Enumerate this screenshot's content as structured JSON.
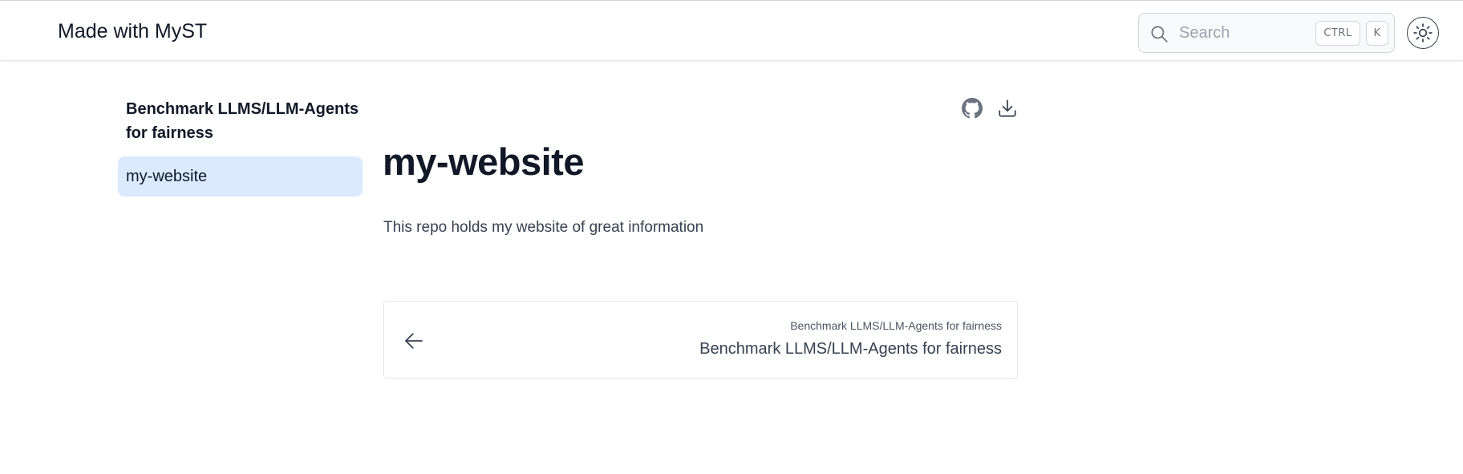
{
  "header": {
    "brand": "Made with MyST",
    "search": {
      "placeholder": "Search",
      "shortcut_ctrl": "CTRL",
      "shortcut_key": "K"
    },
    "theme_toggle_icon": "sun-icon"
  },
  "sidebar": {
    "title": "Benchmark LLMS/LLM-Agents for fairness",
    "items": [
      {
        "label": "my-website",
        "active": true
      }
    ],
    "active_bg": "#dbeafe"
  },
  "main": {
    "action_icons": [
      "github-icon",
      "download-icon"
    ],
    "title": "my-website",
    "description": "This repo holds my website of great information",
    "prev_link": {
      "icon": "arrow-left-icon",
      "small_label": "Benchmark LLMS/LLM-Agents for fairness",
      "label": "Benchmark LLMS/LLM-Agents for fairness"
    }
  }
}
